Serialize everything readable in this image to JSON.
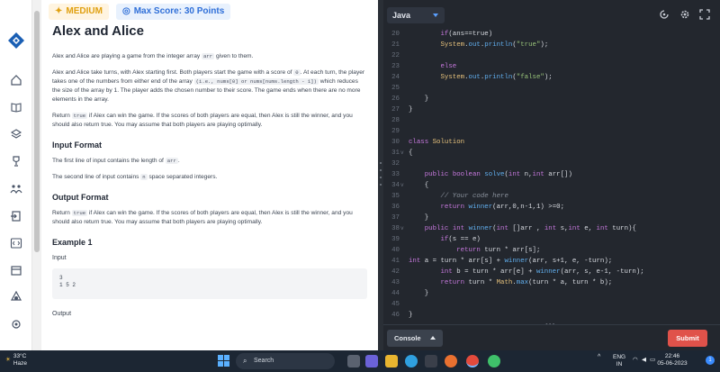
{
  "problem": {
    "difficulty": "MEDIUM",
    "max_score": "Max Score: 30 Points",
    "title": "Alex and Alice",
    "p1": "Alex and Alice are playing a game from the integer array",
    "p1_code": "arr",
    "p1_end": "given to them.",
    "p2_a": "Alex and Alice take turns, with Alex starting first. Both players start the game with a score of",
    "p2_code1": "0",
    "p2_b": ". At each turn, the player takes one of the numbers from either end of the array",
    "p2_code2": "(i.e., nums[0] or nums[nums.length - 1])",
    "p2_c": "which reduces the size of the array by 1. The player adds the chosen number to their score. The game ends when there are no more elements in the array.",
    "p3_a": "Return",
    "p3_code": "true",
    "p3_b": "if Alex can win the game. If the scores of both players are equal, then Alex is still the winner, and you should also return true. You may assume that both players are playing optimally.",
    "input_heading": "Input Format",
    "input_l1_a": "The first line of input contains the length of",
    "input_l1_code": "arr",
    "input_l1_end": ".",
    "input_l2_a": "The second line of input contains",
    "input_l2_code": "n",
    "input_l2_b": "space separated integers.",
    "output_heading": "Output Format",
    "out_a": "Return",
    "out_code": "true",
    "out_b": "if Alex can win the game. If the scores of both players are equal, then Alex is still the winner, and you should also return true. You may assume that both players are playing optimally.",
    "example_heading": "Example 1",
    "input_label": "Input",
    "example_input_l1": "3",
    "example_input_l2": "1 5 2",
    "output_label": "Output"
  },
  "editor": {
    "language": "Java",
    "console_label": "Console",
    "submit_label": "Submit",
    "lines": [
      {
        "n": "20",
        "fold": "",
        "code": "        if(ans==true)"
      },
      {
        "n": "21",
        "fold": "",
        "code": "        System.out.println(\"true\");"
      },
      {
        "n": "22",
        "fold": "",
        "code": ""
      },
      {
        "n": "23",
        "fold": "",
        "code": "        else"
      },
      {
        "n": "24",
        "fold": "",
        "code": "        System.out.println(\"false\");"
      },
      {
        "n": "25",
        "fold": "",
        "code": ""
      },
      {
        "n": "26",
        "fold": "",
        "code": "    }"
      },
      {
        "n": "27",
        "fold": "",
        "code": "}"
      },
      {
        "n": "28",
        "fold": "",
        "code": ""
      },
      {
        "n": "29",
        "fold": "",
        "code": ""
      },
      {
        "n": "30",
        "fold": "",
        "code": "class Solution"
      },
      {
        "n": "31",
        "fold": "v",
        "code": "{"
      },
      {
        "n": "32",
        "fold": "",
        "code": ""
      },
      {
        "n": "33",
        "fold": "",
        "code": "    public boolean solve(int n,int arr[])"
      },
      {
        "n": "34",
        "fold": "v",
        "code": "    {"
      },
      {
        "n": "35",
        "fold": "",
        "code": "        // Your code here"
      },
      {
        "n": "36",
        "fold": "",
        "code": "        return winner(arr,0,n-1,1) >=0;"
      },
      {
        "n": "37",
        "fold": "",
        "code": "    }"
      },
      {
        "n": "38",
        "fold": "v",
        "code": "    public int winner(int []arr , int s,int e, int turn){"
      },
      {
        "n": "39",
        "fold": "",
        "code": "        if(s == e)"
      },
      {
        "n": "40",
        "fold": "",
        "code": "            return turn * arr[s];"
      },
      {
        "n": "41",
        "fold": "",
        "code": "int a = turn * arr[s] + winner(arr, s+1, e, -turn);"
      },
      {
        "n": "42",
        "fold": "",
        "code": "        int b = turn * arr[e] + winner(arr, s, e-1, -turn);"
      },
      {
        "n": "43",
        "fold": "",
        "code": "        return turn * Math.max(turn * a, turn * b);"
      },
      {
        "n": "44",
        "fold": "",
        "code": "    }"
      },
      {
        "n": "45",
        "fold": "",
        "code": ""
      },
      {
        "n": "46",
        "fold": "",
        "code": "}"
      }
    ]
  },
  "taskbar": {
    "temperature": "33°C",
    "weather": "Haze",
    "search_label": "Search",
    "lang_top": "ENG",
    "lang_bottom": "IN",
    "time": "22:46",
    "date": "05-06-2023"
  },
  "colors": {
    "accent_blue": "#2f6fd8",
    "medium_orange": "#e0a010",
    "submit_red": "#e0524a",
    "editor_bg": "#23272e"
  }
}
